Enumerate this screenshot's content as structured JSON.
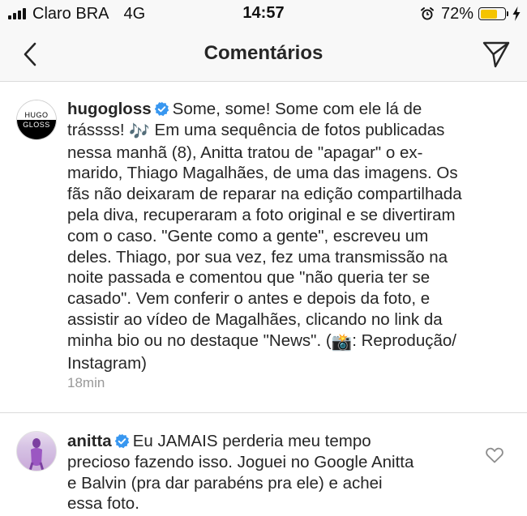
{
  "status_bar": {
    "carrier": "Claro BRA",
    "network": "4G",
    "time": "14:57",
    "battery_percent": "72%",
    "battery_level": 0.72,
    "battery_color": "#f5c400",
    "icons": [
      "signal-icon",
      "alarm-icon",
      "battery-icon",
      "charging-icon"
    ]
  },
  "header": {
    "title": "Comentários",
    "back_icon": "chevron-left-icon",
    "share_icon": "direct-send-icon"
  },
  "caption": {
    "avatar_text_top": "HUGO",
    "avatar_text_bottom": "GLOSS",
    "username": "hugogloss",
    "verified_badge_color": "#3897f0",
    "text_part1": "Some, some! Some com ele lá de\ntrássss! ",
    "music_emoji": "🎶",
    "text_part2": " Em uma sequência de fotos publicadas\nnessa manhã (8), Anitta tratou de \"apagar\" o ex-\nmarido, Thiago Magalhães, de uma das imagens. Os\nfãs não deixaram de reparar na edição compartilhada\npela diva, recuperaram a foto original e se divertiram\ncom o caso. \"Gente como a gente\", escreveu um\ndeles. Thiago, por sua vez, fez uma transmissão na\nnoite passada e comentou que \"não queria ter se\ncasado\". Vem conferir o antes e depois da foto, e\nassistir ao vídeo de Magalhães, clicando no link da\nminha bio ou no destaque \"News\". (",
    "camera_emoji": "📸",
    "text_part3": ": Reprodução/\nInstagram)",
    "timestamp": "18min"
  },
  "comment": {
    "username": "anitta",
    "text": "Eu JAMAIS perderia meu tempo\nprecioso fazendo isso. Joguei no Google Anitta\ne Balvin (pra dar parabéns pra ele) e achei\nessa foto.",
    "like_icon": "heart-outline-icon"
  }
}
